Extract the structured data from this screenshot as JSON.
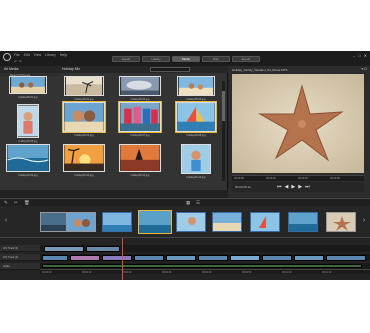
{
  "app": {
    "menu": [
      "File",
      "Edit",
      "View",
      "Library",
      "Help"
    ],
    "mode_tabs": [
      "Import",
      "Library",
      "Movie",
      "Disc",
      "Export"
    ],
    "active_mode_index": 2,
    "window_controls": [
      "–",
      "□",
      "✕"
    ]
  },
  "library": {
    "section_label": "All Media",
    "title": "Holiday Mix",
    "subfolder": "Beach Pictures",
    "thumbnails": [
      {
        "label": "holidayPic01.jpg"
      },
      {
        "label": "holidayPic02.jpg"
      },
      {
        "label": "holidayPic03.jpg"
      },
      {
        "label": "holidayPic04.jpg"
      },
      {
        "label": "holidayPic05.jpg"
      },
      {
        "label": "holidayPic06.jpg"
      },
      {
        "label": "holidayPic07.jpg"
      },
      {
        "label": "holidayPic08.jpg"
      },
      {
        "label": "holidayPic09.jpg"
      },
      {
        "label": "holidayPic10.jpg"
      },
      {
        "label": "holidayPic11.jpg"
      },
      {
        "label": "holidayPic12.jpg"
      }
    ]
  },
  "player": {
    "title": "Holiday_Family_Vacation_04_Movie.MTS",
    "ruler_ticks": [
      "00:00:00",
      "00:00:10",
      "00:00:20",
      "00:00:30"
    ],
    "timecode": "00:00:08.12"
  },
  "timeline": {
    "tracks": [
      "A/V Track (1)",
      "A/V Track (2)",
      "Audio"
    ],
    "ruler_ticks": [
      "00:00:00",
      "00:00:10",
      "00:00:20",
      "00:00:30",
      "00:00:40",
      "00:00:50",
      "00:01:00",
      "00:01:10"
    ]
  },
  "colors": {
    "accent": "#e8b93a",
    "playhead": "#e14a3b"
  }
}
